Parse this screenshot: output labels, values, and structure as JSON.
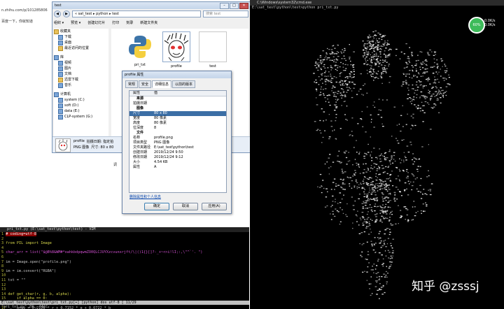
{
  "browser": {
    "url": "n.zhihu.com/p/101285806",
    "line2": "百度一下，你就知道"
  },
  "explorer": {
    "title": "test",
    "address": "« sat_test ▸ python ▸ test",
    "search_placeholder": "搜索 test",
    "menu": [
      "组织 ▾",
      "预览 ▾",
      "创建幻灯片",
      "打印",
      "刻录",
      "新建文件夹"
    ],
    "nav": {
      "favorites": "收藏夹",
      "fav_items": [
        "下载",
        "桌面",
        "最近访问的位置"
      ],
      "libraries": "库",
      "lib_items": [
        "视频",
        "图片",
        "文档",
        "迅雷下载",
        "音乐"
      ],
      "computer": "计算机",
      "drives": [
        "system (C:)",
        "soft (D:)",
        "data (E:)",
        "CLP-system (G:)"
      ]
    },
    "files": [
      {
        "name": "pri_txt",
        "type": "python"
      },
      {
        "name": "profile",
        "type": "image"
      },
      {
        "name": "test",
        "type": "blank"
      }
    ],
    "details": {
      "name": "profile",
      "kind": "PNG 图像",
      "date_label": "拍摄日期: 指定拍",
      "size_label": "尺寸: 80 x 80"
    }
  },
  "props": {
    "title": "profile 属性",
    "tabs": [
      "常规",
      "安全",
      "详细信息",
      "以前的版本"
    ],
    "col_prop": "属性",
    "col_val": "值",
    "rows": [
      {
        "k": "来源",
        "v": "",
        "sec": true
      },
      {
        "k": "拍摄日期",
        "v": ""
      },
      {
        "k": "图像",
        "v": "",
        "sec": true
      },
      {
        "k": "尺寸",
        "v": "80 x 80",
        "sel": true
      },
      {
        "k": "宽度",
        "v": "80 像素"
      },
      {
        "k": "高度",
        "v": "80 像素"
      },
      {
        "k": "位深度",
        "v": "8"
      },
      {
        "k": "文件",
        "v": "",
        "sec": true
      },
      {
        "k": "名称",
        "v": "profile.png"
      },
      {
        "k": "项目类型",
        "v": "PNG 图像"
      },
      {
        "k": "文件夹路径",
        "v": "E:\\sat_test\\python\\test"
      },
      {
        "k": "创建日期",
        "v": "2019/12/24 9:50"
      },
      {
        "k": "修改日期",
        "v": "2019/12/24 9:12"
      },
      {
        "k": "大小",
        "v": "4.54 KB"
      },
      {
        "k": "属性",
        "v": "A"
      }
    ],
    "link": "删除属性和个人信息",
    "ok": "确定",
    "cancel": "取消",
    "apply": "应用(A)"
  },
  "midlabel": "调",
  "vim": {
    "title": "pri_txt.py (E:\\sat_test\\python\\test) - VIM",
    "lines": [
      {
        "n": "1",
        "t": "# coding=utf-8",
        "cls": "hl"
      },
      {
        "n": "2",
        "t": "",
        "cls": ""
      },
      {
        "n": "3",
        "t": "from PIL import Image",
        "cls": "kw"
      },
      {
        "n": "4",
        "t": "",
        "cls": ""
      },
      {
        "n": "5",
        "t": "char_arr = list(\"$@B%8&WM#*oahkbdpqwmZO0QLCJUYXzcvunxrjft/\\|()1{}[]?-_+~<>i!lI;:,\\\"^`'. \")",
        "cls": "str"
      },
      {
        "n": "6",
        "t": "",
        "cls": ""
      },
      {
        "n": "7",
        "t": "im = Image.open(\"profile.png\")",
        "cls": ""
      },
      {
        "n": "8",
        "t": "",
        "cls": ""
      },
      {
        "n": "9",
        "t": "im = im.convert(\"RGBA\")",
        "cls": ""
      },
      {
        "n": "10",
        "t": "",
        "cls": ""
      },
      {
        "n": "11",
        "t": "txt = \"\"",
        "cls": ""
      },
      {
        "n": "12",
        "t": "",
        "cls": ""
      },
      {
        "n": "13",
        "t": "",
        "cls": ""
      },
      {
        "n": "14",
        "t": "def get_char(r, g, b, alpha):",
        "cls": "kw"
      },
      {
        "n": "15",
        "t": "    if alpha == 0:",
        "cls": "kw"
      },
      {
        "n": "16",
        "t": "        return ' '",
        "cls": "kw"
      },
      {
        "n": "17",
        "t": "    gray = 0.2126 * r + 0.7152 * g + 0.0722 * b",
        "cls": ""
      },
      {
        "n": "18",
        "t": "    unit = (256.0 + 1) / len(char_arr)",
        "cls": ""
      }
    ],
    "status": "E:\\sat_test\\python\\test\\pri_txt.py[+]                          [python] dos utf-8 [ 11/29",
    "cmdline": "\"pri_txt.py\" 29L, 681C"
  },
  "cmd": {
    "title": "C:\\Windows\\system32\\cmd.exe",
    "prompt": "E:\\sat_test\\python\\test>python pri_txt.py"
  },
  "watermark": "知乎 @zsssj",
  "gauge": {
    "value": "60%",
    "line1": "0.0K/s",
    "line2": "0.0K/s"
  }
}
